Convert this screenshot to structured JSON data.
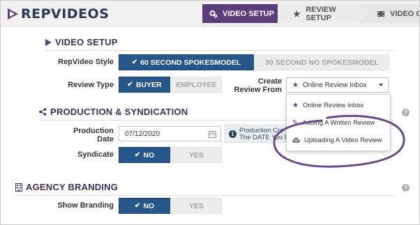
{
  "app": {
    "logo_text": "REPVIDEOS"
  },
  "steps": [
    {
      "label": "VIDEO SETUP",
      "icon": "gears-icon"
    },
    {
      "label": "REVIEW SETUP",
      "icon": "star-icon"
    },
    {
      "label": "VIDEO OPT",
      "icon": "film-icon"
    }
  ],
  "video_setup": {
    "title": "VIDEO SETUP",
    "style_label": "RepVideo Style",
    "style_options": [
      "60 SECOND SPOKESMODEL",
      "30 SECOND NO SPOKESMODEL"
    ],
    "style_selected": "60 SECOND SPOKESMODEL",
    "review_type_label": "Review Type",
    "review_type_options": [
      "BUYER",
      "EMPLOYEE"
    ],
    "review_type_selected": "BUYER",
    "create_from_label_1": "Create",
    "create_from_label_2": "Review From",
    "create_from_value": "Online Review Inbox",
    "create_from_options": [
      "Online Review Inbox",
      "Adding A Written Review",
      "Uploading A Video Review"
    ]
  },
  "production": {
    "title": "PRODUCTION & SYNDICATION",
    "date_label_1": "Production",
    "date_label_2": "Date",
    "date_value": "07/12/2020",
    "info_line_1": "Production Cre",
    "info_line_2": "The DATE You P",
    "syndicate_label": "Syndicate",
    "syndicate_options": [
      "NO",
      "YES"
    ],
    "syndicate_selected": "NO"
  },
  "branding": {
    "title": "AGENCY BRANDING",
    "show_label": "Show Branding",
    "show_options": [
      "NO",
      "YES"
    ],
    "show_selected": "NO"
  },
  "colors": {
    "brand_purple": "#5a3d7a",
    "button_blue": "#27578a",
    "annotation_purple": "#6b4a8c"
  }
}
